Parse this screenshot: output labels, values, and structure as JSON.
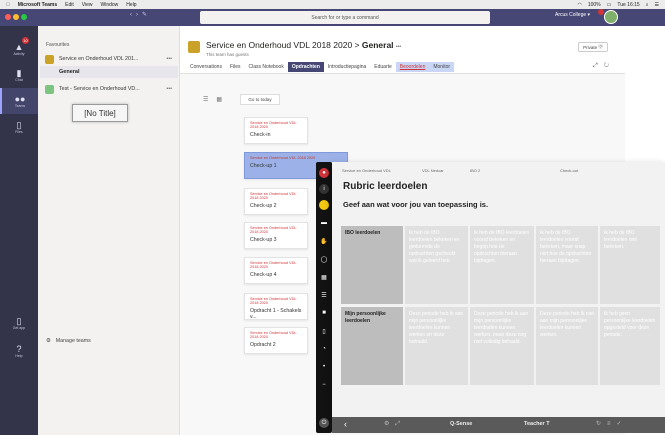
{
  "menubar": {
    "apple": "",
    "app": "Microsoft Teams",
    "items": [
      "Edit",
      "View",
      "Window",
      "Help"
    ],
    "battery": "100%",
    "time": "Tue 16:15"
  },
  "titlebar": {
    "search_placeholder": "Search for or type a command",
    "tenant": "Arcus College"
  },
  "rail": {
    "badge": "10",
    "items": [
      {
        "label": "Activity",
        "icon": "bell-icon",
        "glyph": "🔔"
      },
      {
        "label": "Chat",
        "icon": "chat-icon",
        "glyph": "💬"
      },
      {
        "label": "Teams",
        "icon": "teams-icon",
        "glyph": "👥"
      },
      {
        "label": "Files",
        "icon": "files-icon",
        "glyph": "📄"
      },
      {
        "label": "Get app",
        "icon": "device-icon",
        "glyph": "▯"
      },
      {
        "label": "Help",
        "icon": "help-icon",
        "glyph": "?"
      }
    ]
  },
  "teams": {
    "favourites": "Favourites",
    "team1": "Service en Onderhoud VDL 201...",
    "team1_channel": "General",
    "team2": "Test - Service en Onderhoud VD...",
    "dots": "•••",
    "tooltip": "[No Title]",
    "manage": "Manage teams"
  },
  "channel": {
    "team": "Service en Onderhoud VDL 2018 2020",
    "separator": " > ",
    "name": "General",
    "more": "•••",
    "subtitle": "This team has guests",
    "private": "Private",
    "tabs": [
      {
        "label": "Conversations",
        "style": "normal"
      },
      {
        "label": "Files",
        "style": "normal"
      },
      {
        "label": "Class Notebook",
        "style": "normal"
      },
      {
        "label": "Opdrachten",
        "style": "active"
      },
      {
        "label": "Introductiepagina",
        "style": "normal"
      },
      {
        "label": "Eduarte",
        "style": "normal"
      },
      {
        "label": "Beoordelen",
        "style": "red"
      },
      {
        "label": "Monitor",
        "style": "hl"
      }
    ]
  },
  "assignments": {
    "goto_today": "Go to today",
    "cards": [
      {
        "team": "Service en Onderhoud VDL 2018 2020",
        "name": "Check-in",
        "selected": false
      },
      {
        "team": "Service en Onderhoud VDL 2018 2020",
        "name": "Check-up 1",
        "selected": true
      },
      {
        "team": "Service en Onderhoud VDL 2018 2020",
        "name": "Check-up 2",
        "selected": false
      },
      {
        "team": "Service en Onderhoud VDL 2018 2020",
        "name": "Check-up 3",
        "selected": false
      },
      {
        "team": "Service en Onderhoud VDL 2018 2020",
        "name": "Check-up 4",
        "selected": false
      },
      {
        "team": "Service en Onderhoud VDL 2018 2020",
        "name": "Opdracht 1 - Schakels v...",
        "selected": false
      },
      {
        "team": "Service en Onderhoud VDL 2018 2020",
        "name": "Opdracht 2",
        "selected": false
      }
    ]
  },
  "rubric": {
    "header": [
      "Service en Onderhoud VDL",
      "VDL Nedcar",
      "IBO 2",
      "Check-out"
    ],
    "title": "Rubric leerdoelen",
    "subtitle": "Geef aan wat voor jou van toepassing is.",
    "rows": [
      {
        "label": "IBO leerdoelen",
        "cells": [
          "Ik heb de IBO leerdoelen bekeken en gedurende de opdrachten gecheckt wat ik geleerd heb.",
          "Ik heb de IBO leerdoelen vooraf bekeken en begrip hoe de opdrachten hieraan bijdragen.",
          "Ik heb de IBO leerdoelen vooraf bekeken, maar snap niet hoe de opdrachten hieraan bijdragen.",
          "Ik heb de IBO leerdoelen niet bekeken."
        ]
      },
      {
        "label": "Mijn persoonlijke leerdoelen",
        "cells": [
          "Deze periode heb ik aan mijn persoonlijke leerdoelen kunnen werken en deze behaald.",
          "Deze periode heb ik aan mijn persoonlijke leerdoelen kunnen werken, maar deze nog niet volledig behaald.",
          "Deze periode heb ik niet aan mijn persoonlijke leerdoelen kunnen werken.",
          "Ik heb geen persoonlijke leerdoelen opgesteld voor deze periode."
        ]
      }
    ],
    "bottombar": {
      "app": "Q-Sense",
      "user": "Teacher T"
    }
  },
  "colors": {
    "teams_purple": "#464775",
    "rail": "#33344a",
    "selected_card": "#9cb1e8",
    "accent_red": "#d13438"
  }
}
